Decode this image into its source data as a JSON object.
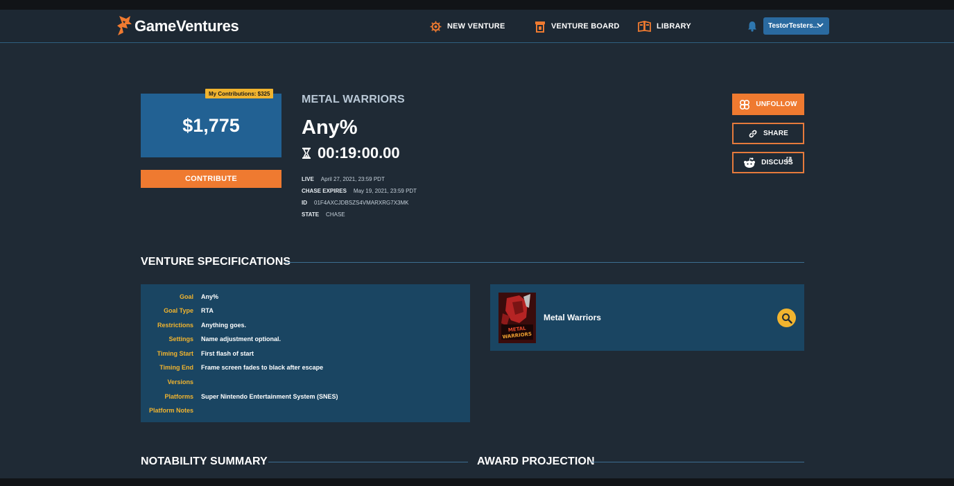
{
  "brand": {
    "name": "GameVentures"
  },
  "nav": {
    "items": [
      {
        "label": "NEW VENTURE",
        "icon": "gear-icon"
      },
      {
        "label": "VENTURE BOARD",
        "icon": "board-icon"
      },
      {
        "label": "LIBRARY",
        "icon": "library-icon"
      }
    ],
    "user": "TestorTesters..."
  },
  "venture": {
    "amount": "$1,775",
    "contributions_badge": "My Contributions: $325",
    "contribute_label": "CONTRIBUTE",
    "game_title": "METAL WARRIORS",
    "goal": "Any%",
    "timer": "00:19:00.00",
    "meta": [
      {
        "key": "LIVE",
        "value": "April 27, 2021, 23:59 PDT"
      },
      {
        "key": "CHASE EXPIRES",
        "value": "May 19, 2021, 23:59 PDT"
      },
      {
        "key": "ID",
        "value": "01F4AXCJDBSZS4VMARXRG7X3MK"
      },
      {
        "key": "STATE",
        "value": "CHASE"
      }
    ]
  },
  "actions": {
    "unfollow": "UNFOLLOW",
    "share": "SHARE",
    "discuss": "DISCUSS"
  },
  "specs": {
    "title": "VENTURE SPECIFICATIONS",
    "rows": [
      {
        "label": "Goal",
        "value": "Any%"
      },
      {
        "label": "Goal Type",
        "value": "RTA"
      },
      {
        "label": "Restrictions",
        "value": "Anything goes."
      },
      {
        "label": "Settings",
        "value": "Name adjustment optional."
      },
      {
        "label": "Timing Start",
        "value": "First flash of start"
      },
      {
        "label": "Timing End",
        "value": "Frame screen fades to black after escape"
      },
      {
        "label": "Versions",
        "value": ""
      },
      {
        "label": "Platforms",
        "value": "Super Nintendo Entertainment System (SNES)"
      },
      {
        "label": "Platform Notes",
        "value": ""
      }
    ]
  },
  "game_card": {
    "name": "Metal Warriors",
    "cover_text": "METAL WARRIORS"
  },
  "sections": {
    "notability": "NOTABILITY SUMMARY",
    "award": "AWARD PROJECTION"
  },
  "colors": {
    "background": "#1f2a35",
    "accent_orange": "#ef7a30",
    "accent_yellow": "#f1b42f",
    "panel_blue": "#1a4562",
    "amount_blue": "#226193"
  }
}
